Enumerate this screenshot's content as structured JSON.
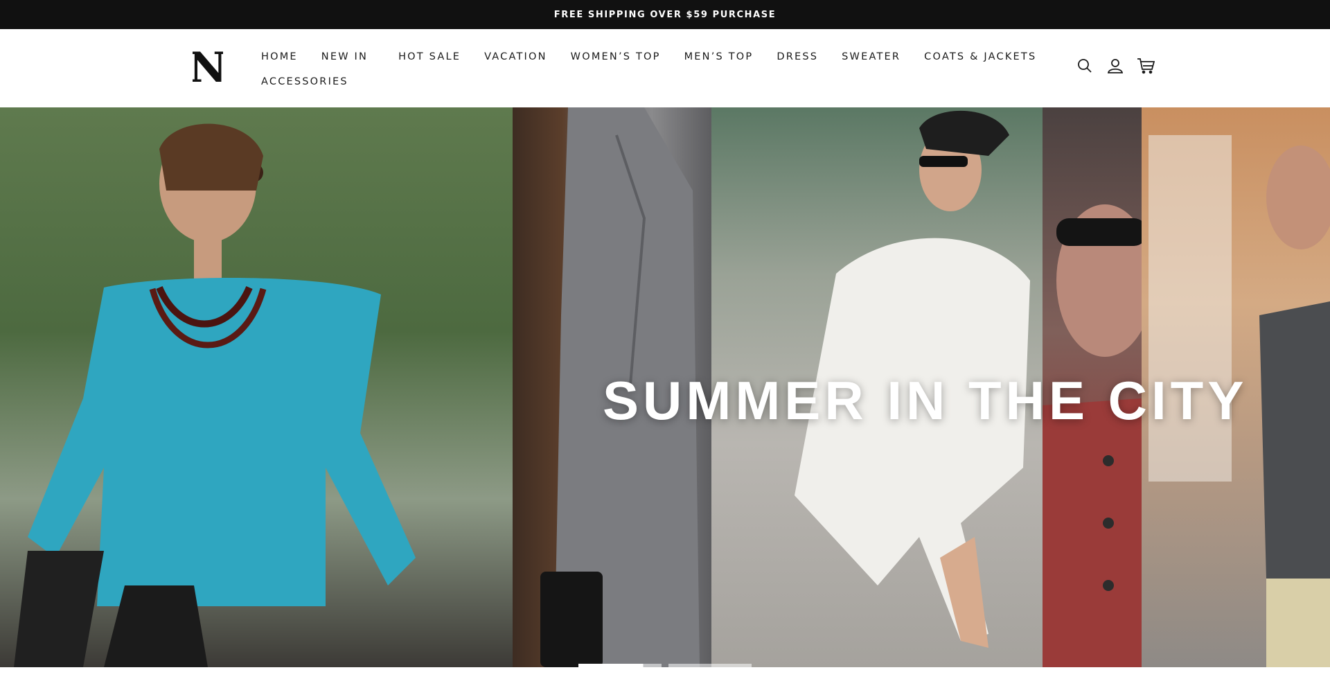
{
  "announcement": {
    "text": "FREE SHIPPING OVER $59 PURCHASE"
  },
  "brand": {
    "logo_letter": "N"
  },
  "nav": {
    "row1": [
      "HOME",
      "NEW IN",
      "HOT SALE",
      "VACATION",
      "WOMEN’S TOP",
      "MEN’S TOP",
      "DRESS",
      "SWEATER",
      "COATS & JACKETS"
    ],
    "row2": [
      "ACCESSORIES"
    ]
  },
  "header_icons": [
    "search-icon",
    "account-icon",
    "cart-icon"
  ],
  "hero": {
    "title": "SUMMER IN THE CITY"
  },
  "carousel": {
    "slides": 3,
    "active": 1
  },
  "colors": {
    "announcement_bg": "#111111",
    "text": "#1a1a1a",
    "hero_text": "#ffffff"
  }
}
